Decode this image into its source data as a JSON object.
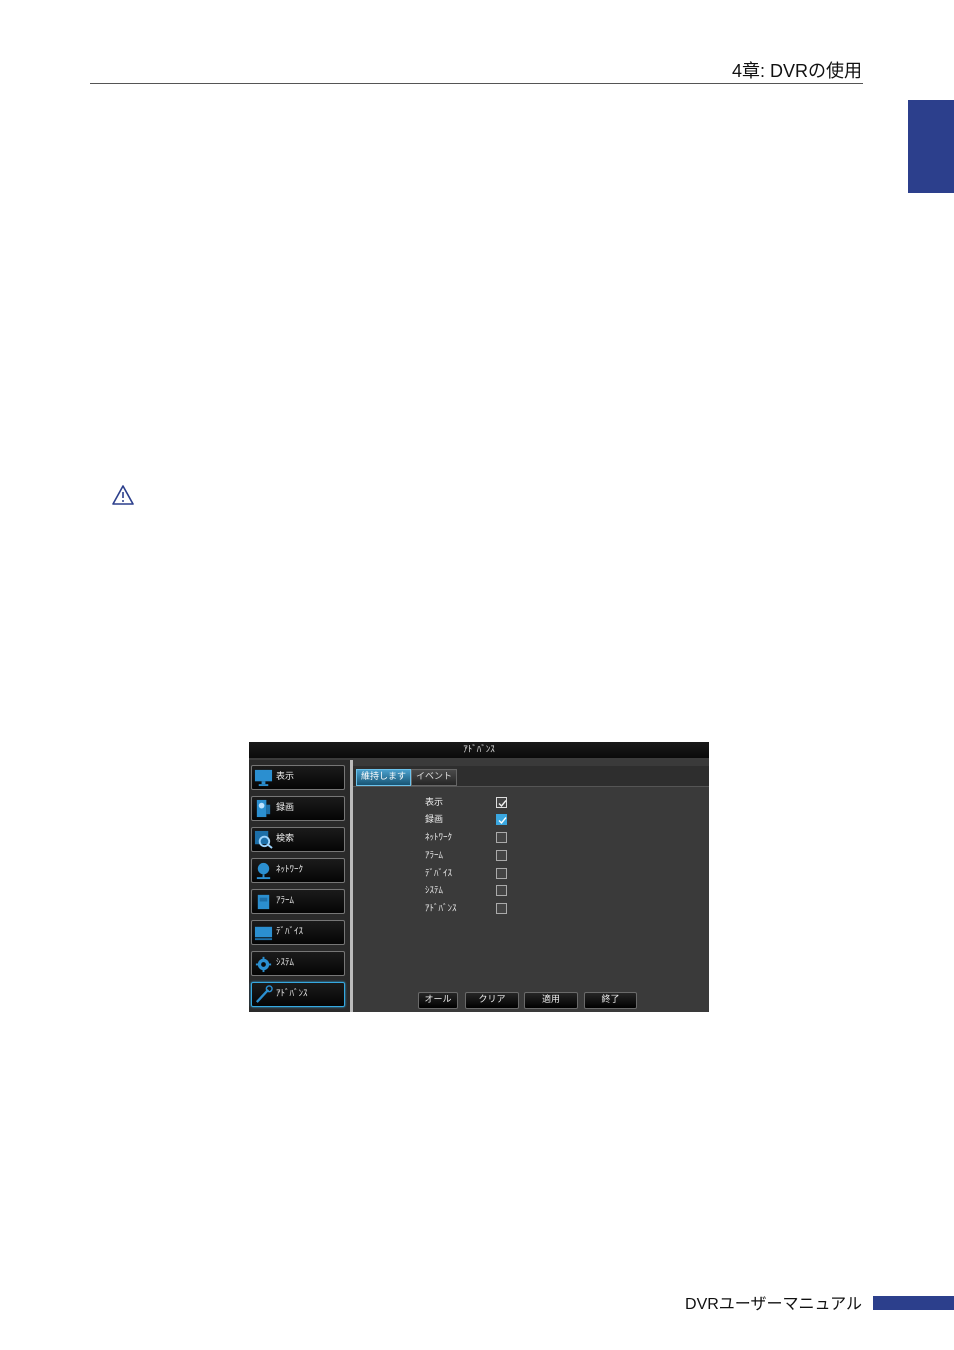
{
  "header": {
    "chapter_title": "4章: DVRの使用"
  },
  "footer": {
    "manual_title": "DVRユーザーマニュアル"
  },
  "colors": {
    "brand_blue": "#2c3f8c",
    "accent_blue": "#35a8e0"
  },
  "dvr": {
    "window_title": "ｱﾄﾞﾊﾞﾝｽ",
    "sidebar": [
      {
        "label": "表示",
        "icon": "monitor-icon"
      },
      {
        "label": "録画",
        "icon": "record-icon"
      },
      {
        "label": "検索",
        "icon": "search-icon"
      },
      {
        "label": "ﾈｯﾄﾜｰｸ",
        "icon": "network-icon"
      },
      {
        "label": "ｱﾗｰﾑ",
        "icon": "alarm-icon"
      },
      {
        "label": "ﾃﾞﾊﾞｲｽ",
        "icon": "device-icon"
      },
      {
        "label": "ｼｽﾃﾑ",
        "icon": "gear-icon"
      },
      {
        "label": "ｱﾄﾞﾊﾞﾝｽ",
        "icon": "wrench-icon",
        "active": true
      }
    ],
    "tabs": [
      {
        "label": "維持します",
        "active": true
      },
      {
        "label": "イベント",
        "active": false
      }
    ],
    "items": [
      {
        "label": "表示",
        "checked": true
      },
      {
        "label": "録画",
        "checked": true
      },
      {
        "label": "ﾈｯﾄﾜｰｸ",
        "checked": false
      },
      {
        "label": "ｱﾗｰﾑ",
        "checked": false
      },
      {
        "label": "ﾃﾞﾊﾞｲｽ",
        "checked": false
      },
      {
        "label": "ｼｽﾃﾑ",
        "checked": false
      },
      {
        "label": "ｱﾄﾞﾊﾞﾝｽ",
        "checked": false
      }
    ],
    "buttons": {
      "all": "オール",
      "clear": "クリア",
      "apply": "適用",
      "exit": "終了"
    }
  }
}
